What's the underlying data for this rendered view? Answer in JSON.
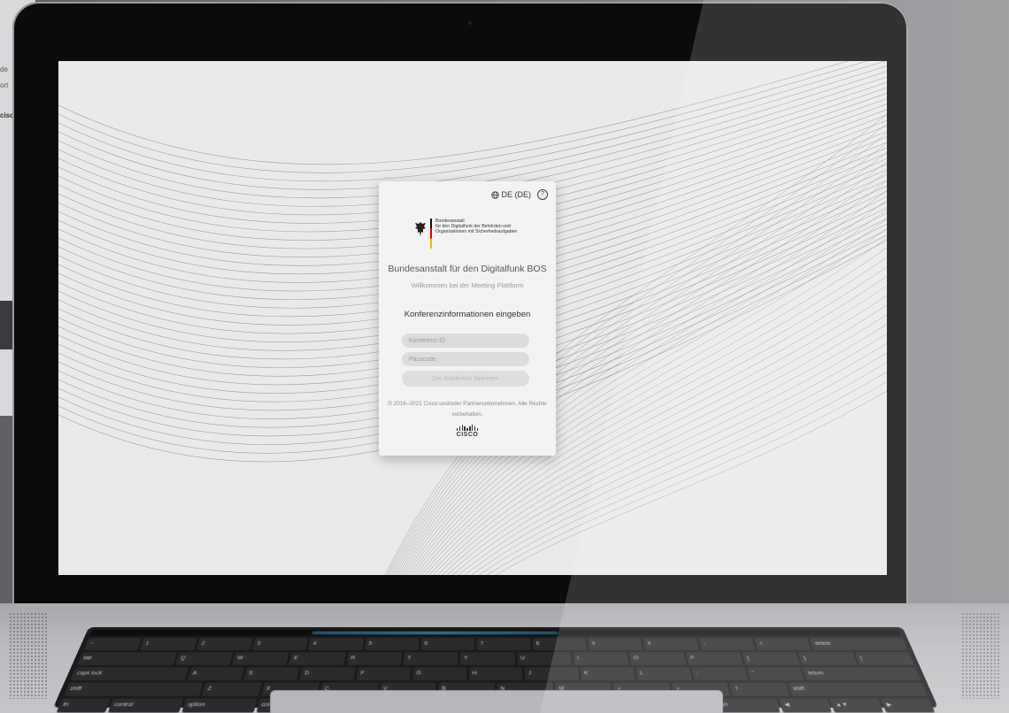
{
  "background_window": {
    "line1": "de",
    "line2": "ort",
    "logo": "cisc"
  },
  "card": {
    "language": "DE (DE)",
    "help_symbol": "?",
    "logo_lines": [
      "Bundesanstalt",
      "für den Digitalfunk der Behörden und",
      "Organisationen mit Sicherheitsaufgaben"
    ],
    "org_title": "Bundesanstalt für den Digitalfunk BOS",
    "welcome": "Willkommen bei der Meeting Plattform",
    "heading": "Konferenzinformationen eingeben",
    "conference_id_placeholder": "Konferenz-ID",
    "passcode_placeholder": "Passcode",
    "join_button": "Der Konferenz beitreten",
    "copyright": "© 2016–2021 Cisco und/oder Partnerunternehmen. Alle Rechte vorbehalten.",
    "cisco_word": "CISCO"
  },
  "keyboard": {
    "row1": [
      "~",
      "1",
      "2",
      "3",
      "4",
      "5",
      "6",
      "7",
      "8",
      "9",
      "0",
      "-",
      "=",
      "delete"
    ],
    "row2": [
      "tab",
      "Q",
      "W",
      "E",
      "R",
      "T",
      "Y",
      "U",
      "I",
      "O",
      "P",
      "{",
      "}",
      "|"
    ],
    "row3": [
      "caps lock",
      "A",
      "S",
      "D",
      "F",
      "G",
      "H",
      "J",
      "K",
      "L",
      ":",
      "\"",
      "return"
    ],
    "row4": [
      "shift",
      "Z",
      "X",
      "C",
      "V",
      "B",
      "N",
      "M",
      "<",
      ">",
      "?",
      "shift"
    ],
    "row5": [
      "fn",
      "control",
      "option",
      "command",
      "",
      "command",
      "option",
      "◀",
      "▲▼",
      "▶"
    ]
  },
  "colors": {
    "screen_bg": "#e9eaeb",
    "card_bg": "#f3f3f3",
    "field_bg": "#dcdcdc"
  }
}
